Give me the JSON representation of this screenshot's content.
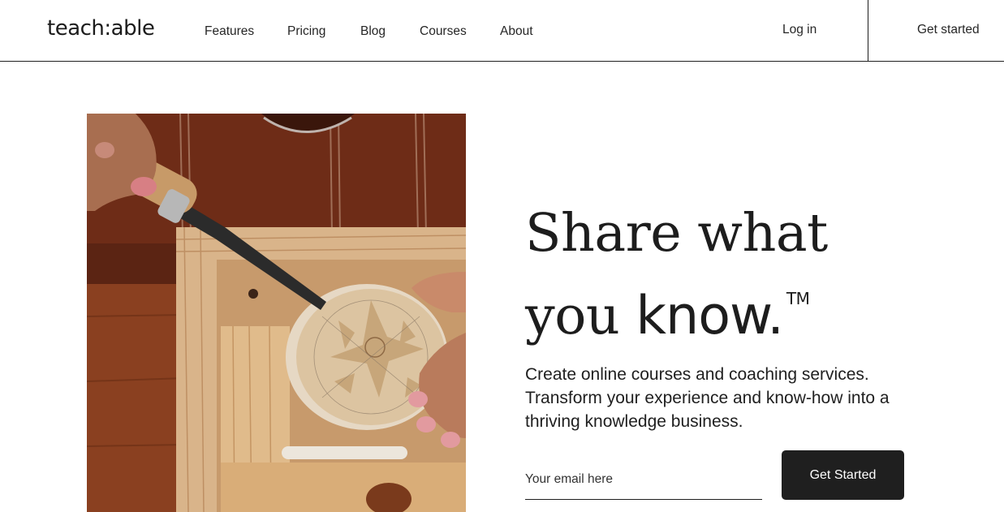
{
  "brand": {
    "logo_text": "teach:able"
  },
  "nav": {
    "items": [
      {
        "label": "Features"
      },
      {
        "label": "Pricing"
      },
      {
        "label": "Blog"
      },
      {
        "label": "Courses"
      },
      {
        "label": "About"
      }
    ],
    "login_label": "Log in",
    "get_started_label": "Get started"
  },
  "hero": {
    "headline_line1": "Share what",
    "headline_line2_serif": "you ",
    "headline_line2_sans": "know.",
    "trademark": "TM",
    "subtext": "Create online courses and coaching services. Transform your experience and know-how into a thriving knowledge business.",
    "email_placeholder": "Your email here",
    "cta_label": "Get Started",
    "image_alt": "hands carving a wooden bowl with a chisel"
  },
  "colors": {
    "text": "#1c1c1c",
    "button_bg": "#1f1f1f",
    "button_text": "#ffffff",
    "background": "#ffffff"
  }
}
